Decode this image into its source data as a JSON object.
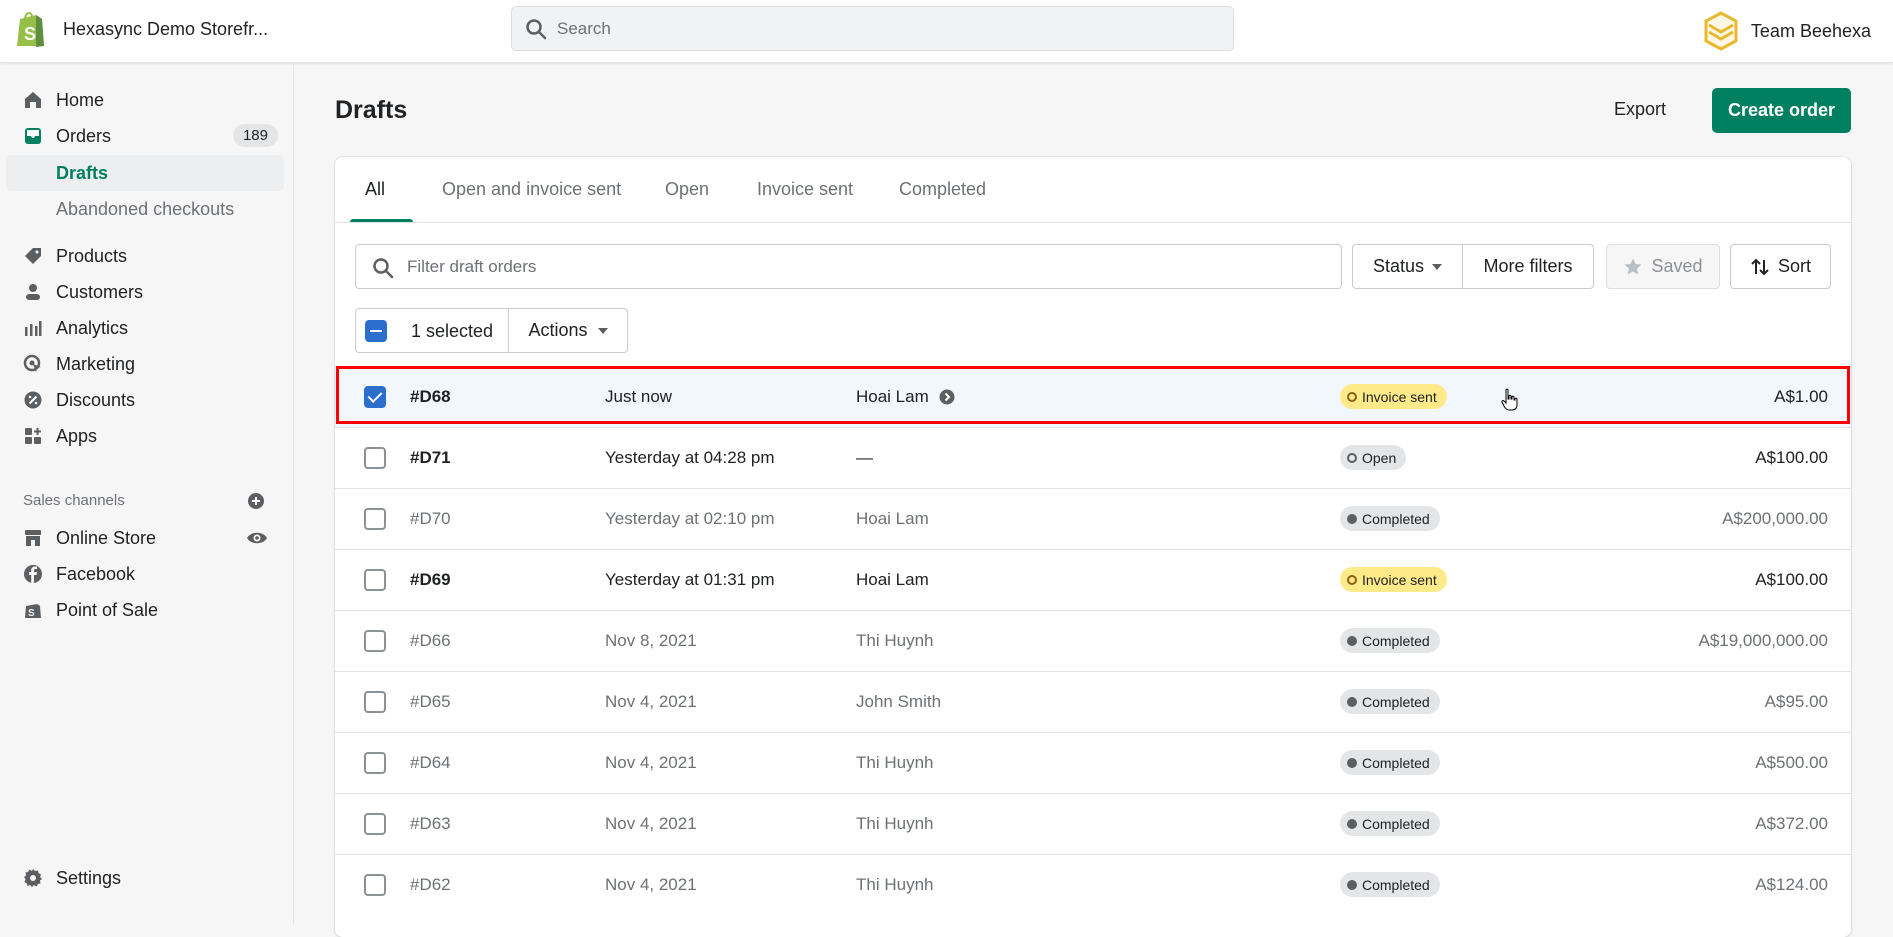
{
  "topbar": {
    "store_name": "Hexasync Demo Storefr...",
    "search_placeholder": "Search",
    "team_name": "Team Beehexa"
  },
  "sidebar": {
    "items": [
      {
        "label": "Home",
        "icon": "home-icon"
      },
      {
        "label": "Orders",
        "icon": "orders-icon",
        "badge": "189"
      },
      {
        "label": "Drafts",
        "active": true
      },
      {
        "label": "Abandoned checkouts"
      },
      {
        "label": "Products",
        "icon": "tag-icon"
      },
      {
        "label": "Customers",
        "icon": "person-icon"
      },
      {
        "label": "Analytics",
        "icon": "bar-chart-icon"
      },
      {
        "label": "Marketing",
        "icon": "target-icon"
      },
      {
        "label": "Discounts",
        "icon": "discount-icon"
      },
      {
        "label": "Apps",
        "icon": "apps-icon"
      }
    ],
    "sales_channels_label": "Sales channels",
    "channels": [
      {
        "label": "Online Store",
        "icon": "store-icon"
      },
      {
        "label": "Facebook",
        "icon": "facebook-icon"
      },
      {
        "label": "Point of Sale",
        "icon": "pos-bag-icon"
      }
    ],
    "settings_label": "Settings"
  },
  "page": {
    "title": "Drafts",
    "export_label": "Export",
    "create_label": "Create order"
  },
  "tabs": [
    {
      "label": "All",
      "active": true
    },
    {
      "label": "Open and invoice sent"
    },
    {
      "label": "Open"
    },
    {
      "label": "Invoice sent"
    },
    {
      "label": "Completed"
    }
  ],
  "filters": {
    "placeholder": "Filter draft orders",
    "status_label": "Status",
    "more_label": "More filters",
    "saved_label": "Saved",
    "sort_label": "Sort"
  },
  "bulk": {
    "selected_label": "1 selected",
    "actions_label": "Actions"
  },
  "colors": {
    "accent": "#008060",
    "invoice_badge": "#ffea8a",
    "neutral_badge": "#e4e5e7",
    "selection": "#2c6ecb",
    "highlight": "#ff0000"
  },
  "orders": [
    {
      "id": "#D68",
      "date": "Just now",
      "customer": "Hoai Lam",
      "status": "Invoice sent",
      "total": "A$1.00",
      "selected": true
    },
    {
      "id": "#D71",
      "date": "Yesterday at 04:28 pm",
      "customer": "—",
      "status": "Open",
      "total": "A$100.00"
    },
    {
      "id": "#D70",
      "date": "Yesterday at 02:10 pm",
      "customer": "Hoai Lam",
      "status": "Completed",
      "total": "A$200,000.00"
    },
    {
      "id": "#D69",
      "date": "Yesterday at 01:31 pm",
      "customer": "Hoai Lam",
      "status": "Invoice sent",
      "total": "A$100.00"
    },
    {
      "id": "#D66",
      "date": "Nov 8, 2021",
      "customer": "Thi Huynh",
      "status": "Completed",
      "total": "A$19,000,000.00"
    },
    {
      "id": "#D65",
      "date": "Nov 4, 2021",
      "customer": "John Smith",
      "status": "Completed",
      "total": "A$95.00"
    },
    {
      "id": "#D64",
      "date": "Nov 4, 2021",
      "customer": "Thi Huynh",
      "status": "Completed",
      "total": "A$500.00"
    },
    {
      "id": "#D63",
      "date": "Nov 4, 2021",
      "customer": "Thi Huynh",
      "status": "Completed",
      "total": "A$372.00"
    },
    {
      "id": "#D62",
      "date": "Nov 4, 2021",
      "customer": "Thi Huynh",
      "status": "Completed",
      "total": "A$124.00"
    }
  ]
}
